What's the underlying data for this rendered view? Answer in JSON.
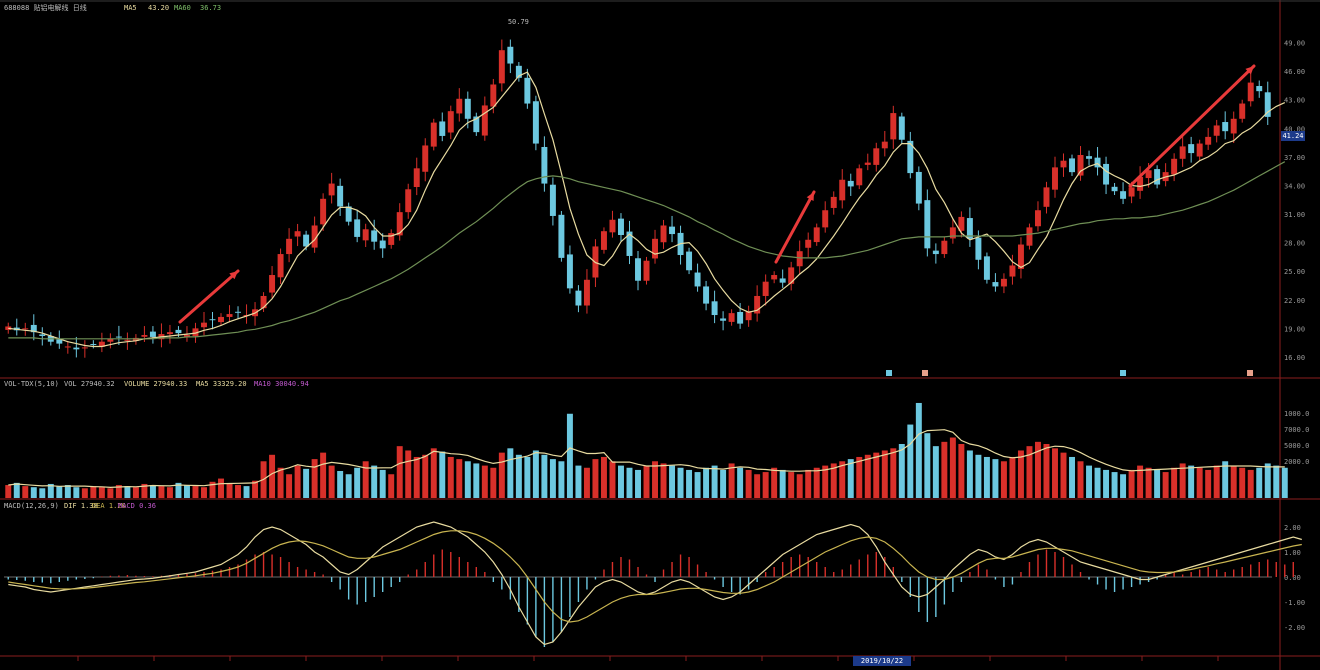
{
  "header": {
    "security": "688088 贴铝电解线 日线",
    "ma_label": "MA5",
    "ma_value": "43.20",
    "price_label": "MA60",
    "price_value": "36.73"
  },
  "colors": {
    "background": "#000000",
    "up_candle": "#d9302a",
    "down_candle": "#6cc8e0",
    "ma_short": "#e8dba0",
    "ma_long": "#6f8f55",
    "arrow": "#e83a3a",
    "axis": "#8a1e1e",
    "macd_dif": "#e8dba0",
    "macd_dea": "#c8b450"
  },
  "volume_header": {
    "label": "VOL-TDX(5,10)",
    "vol": "VOL 27940.32",
    "volume": "VOLUME 27940.33",
    "ma5": "MA5 33329.20",
    "ma10": "MA10 30040.94"
  },
  "macd_header": {
    "label": "MACD(12,26,9)",
    "dif": "DIF 1.38",
    "dea": "DEA 1.20",
    "macd": "MACD 0.36"
  },
  "current_price_tag": "41.24",
  "bottom_date_tag": "2019/10/22",
  "chart_data": [
    {
      "type": "candlestick",
      "title": "",
      "peak_label": "50.79",
      "y_ticks": [
        "49.00",
        "46.00",
        "43.00",
        "40.00",
        "37.00",
        "34.00",
        "31.00",
        "28.00",
        "25.00",
        "22.00",
        "19.00",
        "16.00"
      ],
      "ylim": [
        14,
        52
      ],
      "closes": [
        19.2,
        18.8,
        19.0,
        18.6,
        18.2,
        17.6,
        17.4,
        17.1,
        16.8,
        17.0,
        17.3,
        17.6,
        17.9,
        18.1,
        17.8,
        18.0,
        18.3,
        18.1,
        18.4,
        18.6,
        18.5,
        18.3,
        19.0,
        19.6,
        19.9,
        20.2,
        20.5,
        20.7,
        20.4,
        21.0,
        22.4,
        24.6,
        26.8,
        28.4,
        29.2,
        27.6,
        29.8,
        32.6,
        34.2,
        31.8,
        30.2,
        28.6,
        29.4,
        28.1,
        27.4,
        29.0,
        31.2,
        33.6,
        35.8,
        38.2,
        40.6,
        39.2,
        41.8,
        43.1,
        41.0,
        39.6,
        42.4,
        44.6,
        48.2,
        46.8,
        45.3,
        42.6,
        38.4,
        34.2,
        30.8,
        26.4,
        23.2,
        21.4,
        24.1,
        27.6,
        29.2,
        30.4,
        28.8,
        26.6,
        24.0,
        26.1,
        28.4,
        29.8,
        28.9,
        26.7,
        25.1,
        23.4,
        21.6,
        20.4,
        19.8,
        20.6,
        19.5,
        20.8,
        22.4,
        23.9,
        24.6,
        23.8,
        25.4,
        27.1,
        28.3,
        29.6,
        31.4,
        32.8,
        34.6,
        33.9,
        35.8,
        36.4,
        37.9,
        38.6,
        41.6,
        38.8,
        35.3,
        32.1,
        27.4,
        26.8,
        28.2,
        29.6,
        30.7,
        28.4,
        26.2,
        24.1,
        23.4,
        24.2,
        25.6,
        27.8,
        29.6,
        31.4,
        33.8,
        35.9,
        36.6,
        35.4,
        37.2,
        36.8,
        35.9,
        34.1,
        33.4,
        32.6,
        33.8,
        34.9,
        35.6,
        34.1,
        35.4,
        36.8,
        38.1,
        37.4,
        38.4,
        39.1,
        40.3,
        39.7,
        41.0,
        42.6,
        44.8,
        43.9,
        41.2
      ],
      "ma_short": [
        19.0,
        18.9,
        18.8,
        18.7,
        18.5,
        18.2,
        17.9,
        17.6,
        17.4,
        17.2,
        17.1,
        17.1,
        17.3,
        17.5,
        17.6,
        17.7,
        17.9,
        18.0,
        18.1,
        18.2,
        18.3,
        18.4,
        18.5,
        18.8,
        19.0,
        19.3,
        19.7,
        20.0,
        20.3,
        20.6,
        21.2,
        22.1,
        23.4,
        25.0,
        26.6,
        27.5,
        28.3,
        29.6,
        30.9,
        31.7,
        31.7,
        31.4,
        30.8,
        29.6,
        28.7,
        28.7,
        29.0,
        29.9,
        31.4,
        33.5,
        35.4,
        36.8,
        38.2,
        39.8,
        40.6,
        41.0,
        41.6,
        42.2,
        43.3,
        44.4,
        45.5,
        45.9,
        44.3,
        41.5,
        38.8,
        35.3,
        31.6,
        28.9,
        26.7,
        25.9,
        25.6,
        26.6,
        28.1,
        28.9,
        28.2,
        27.3,
        26.8,
        27.0,
        27.5,
        27.9,
        28.0,
        27.1,
        25.8,
        24.2,
        23.0,
        21.9,
        21.1,
        20.7,
        20.9,
        21.6,
        22.4,
        23.1,
        23.8,
        24.7,
        25.4,
        26.3,
        27.5,
        28.7,
        30.0,
        31.4,
        32.7,
        33.8,
        35.1,
        36.1,
        37.5,
        38.4,
        38.4,
        37.4,
        35.8,
        33.6,
        32.2,
        30.5,
        29.0,
        28.3,
        28.6,
        28.9,
        28.1,
        27.1,
        26.0,
        25.4,
        25.9,
        27.3,
        28.6,
        30.5,
        32.5,
        34.2,
        35.5,
        36.0,
        36.3,
        35.5,
        35.0,
        34.6,
        34.0,
        33.9,
        34.1,
        34.6,
        34.9,
        35.1,
        35.5,
        35.9,
        36.6,
        37.0,
        37.6,
        38.4,
        38.7,
        39.5,
        40.0,
        40.8,
        41.7,
        42.3,
        42.7
      ],
      "ma_long": [
        18.0,
        18.0,
        18.0,
        18.0,
        17.9,
        17.9,
        17.9,
        17.9,
        17.9,
        17.9,
        17.9,
        17.9,
        17.9,
        17.9,
        17.9,
        17.9,
        17.9,
        17.9,
        18.0,
        18.0,
        18.0,
        18.1,
        18.1,
        18.2,
        18.3,
        18.4,
        18.5,
        18.6,
        18.8,
        18.9,
        19.1,
        19.3,
        19.6,
        19.8,
        20.1,
        20.4,
        20.7,
        21.1,
        21.5,
        21.9,
        22.2,
        22.6,
        23.0,
        23.4,
        23.8,
        24.2,
        24.7,
        25.2,
        25.8,
        26.4,
        27.0,
        27.6,
        28.3,
        29.0,
        29.6,
        30.2,
        30.9,
        31.6,
        32.4,
        33.1,
        33.8,
        34.4,
        34.7,
        34.9,
        35.0,
        34.9,
        34.7,
        34.4,
        34.2,
        34.0,
        33.8,
        33.6,
        33.4,
        33.1,
        32.8,
        32.5,
        32.2,
        31.9,
        31.5,
        31.1,
        30.7,
        30.2,
        29.8,
        29.3,
        28.9,
        28.4,
        28.0,
        27.6,
        27.3,
        27.0,
        26.8,
        26.6,
        26.5,
        26.4,
        26.4,
        26.4,
        26.4,
        26.5,
        26.6,
        26.8,
        27.0,
        27.2,
        27.5,
        27.8,
        28.1,
        28.4,
        28.5,
        28.6,
        28.6,
        28.6,
        28.6,
        28.7,
        28.7,
        28.7,
        28.7,
        28.7,
        28.7,
        28.7,
        28.7,
        28.8,
        28.9,
        29.0,
        29.2,
        29.4,
        29.6,
        29.8,
        30.0,
        30.1,
        30.3,
        30.4,
        30.5,
        30.5,
        30.6,
        30.6,
        30.7,
        30.8,
        31.0,
        31.2,
        31.4,
        31.7,
        32.0,
        32.3,
        32.7,
        33.1,
        33.5,
        34.0,
        34.5,
        35.0,
        35.5,
        36.0,
        36.5
      ],
      "arrows": 3
    },
    {
      "type": "bar",
      "title": "",
      "y_ticks": [
        "1000.0",
        "7000.0",
        "5000.0",
        "2000.0"
      ],
      "ylim": [
        0,
        100
      ],
      "values": [
        12,
        14,
        11,
        10,
        9,
        13,
        11,
        12,
        10,
        9,
        11,
        10,
        9,
        12,
        11,
        10,
        13,
        12,
        11,
        10,
        14,
        12,
        11,
        10,
        15,
        18,
        13,
        12,
        11,
        16,
        34,
        40,
        28,
        22,
        30,
        27,
        36,
        42,
        30,
        25,
        22,
        28,
        34,
        30,
        26,
        22,
        48,
        44,
        38,
        40,
        46,
        43,
        38,
        36,
        34,
        32,
        30,
        28,
        42,
        46,
        40,
        38,
        44,
        40,
        36,
        34,
        78,
        30,
        28,
        36,
        38,
        34,
        30,
        28,
        26,
        30,
        34,
        32,
        30,
        28,
        26,
        24,
        28,
        30,
        26,
        32,
        28,
        26,
        22,
        24,
        28,
        26,
        24,
        22,
        26,
        28,
        30,
        32,
        34,
        36,
        38,
        40,
        42,
        44,
        46,
        50,
        68,
        88,
        60,
        48,
        52,
        56,
        50,
        44,
        40,
        38,
        36,
        34,
        38,
        44,
        48,
        52,
        50,
        46,
        42,
        38,
        34,
        30,
        28,
        26,
        24,
        22,
        26,
        30,
        28,
        26,
        24,
        28,
        32,
        30,
        28,
        26,
        30,
        34,
        30,
        28,
        26,
        28,
        32,
        30,
        28
      ],
      "colors_pattern": "up_down_mixed"
    },
    {
      "type": "bar",
      "title": "",
      "y_ticks": [
        "2.00",
        "1.00",
        "0.00",
        "-1.00",
        "-2.00"
      ],
      "ylim": [
        -3,
        2.6
      ],
      "hist": [
        -0.1,
        -0.12,
        -0.15,
        -0.2,
        -0.22,
        -0.25,
        -0.2,
        -0.15,
        -0.1,
        -0.08,
        -0.05,
        0.02,
        0.05,
        0.06,
        0.08,
        0.05,
        0.04,
        0.03,
        0.05,
        0.08,
        0.1,
        0.12,
        0.15,
        0.2,
        0.25,
        0.3,
        0.4,
        0.5,
        0.7,
        0.9,
        1.0,
        0.9,
        0.8,
        0.6,
        0.4,
        0.3,
        0.2,
        0.1,
        -0.2,
        -0.5,
        -0.9,
        -1.1,
        -1.0,
        -0.8,
        -0.6,
        -0.4,
        -0.2,
        0.1,
        0.3,
        0.6,
        0.9,
        1.1,
        1.0,
        0.8,
        0.6,
        0.4,
        0.2,
        -0.2,
        -0.5,
        -0.9,
        -1.4,
        -1.9,
        -2.4,
        -2.8,
        -2.6,
        -2.2,
        -1.6,
        -1.0,
        -0.5,
        -0.1,
        0.3,
        0.6,
        0.8,
        0.7,
        0.4,
        0.1,
        -0.2,
        0.3,
        0.6,
        0.9,
        0.8,
        0.5,
        0.2,
        -0.1,
        -0.4,
        -0.6,
        -0.7,
        -0.5,
        -0.2,
        0.2,
        0.4,
        0.6,
        0.8,
        0.9,
        0.8,
        0.6,
        0.4,
        0.2,
        0.3,
        0.5,
        0.7,
        0.9,
        1.0,
        0.8,
        0.4,
        -0.2,
        -0.8,
        -1.4,
        -1.8,
        -1.6,
        -1.1,
        -0.6,
        -0.2,
        0.2,
        0.5,
        0.3,
        -0.1,
        -0.4,
        -0.3,
        0.2,
        0.6,
        0.9,
        1.1,
        1.0,
        0.8,
        0.5,
        0.2,
        -0.1,
        -0.3,
        -0.5,
        -0.6,
        -0.5,
        -0.4,
        -0.3,
        -0.2,
        -0.1,
        0.1,
        0.2,
        0.1,
        0.2,
        0.3,
        0.4,
        0.3,
        0.2,
        0.3,
        0.4,
        0.5,
        0.6,
        0.7,
        0.6,
        0.5,
        0.6
      ],
      "dif": [
        -0.3,
        -0.35,
        -0.4,
        -0.5,
        -0.55,
        -0.6,
        -0.55,
        -0.5,
        -0.45,
        -0.4,
        -0.35,
        -0.3,
        -0.25,
        -0.2,
        -0.15,
        -0.1,
        -0.08,
        -0.05,
        0.0,
        0.05,
        0.1,
        0.15,
        0.2,
        0.3,
        0.4,
        0.5,
        0.7,
        0.9,
        1.2,
        1.6,
        1.9,
        2.0,
        1.9,
        1.7,
        1.5,
        1.3,
        1.0,
        0.8,
        0.5,
        0.2,
        0.1,
        0.3,
        0.6,
        0.9,
        1.2,
        1.4,
        1.6,
        1.8,
        2.0,
        2.1,
        2.2,
        2.1,
        2.0,
        1.8,
        1.6,
        1.3,
        1.0,
        0.6,
        0.1,
        -0.5,
        -1.2,
        -1.8,
        -2.4,
        -2.7,
        -2.6,
        -2.2,
        -1.7,
        -1.2,
        -0.8,
        -0.4,
        -0.2,
        -0.1,
        -0.2,
        -0.4,
        -0.6,
        -0.7,
        -0.6,
        -0.4,
        -0.2,
        -0.1,
        -0.2,
        -0.4,
        -0.6,
        -0.8,
        -0.9,
        -0.8,
        -0.6,
        -0.3,
        0.0,
        0.3,
        0.6,
        0.9,
        1.1,
        1.3,
        1.5,
        1.7,
        1.8,
        1.9,
        2.0,
        2.1,
        2.0,
        1.7,
        1.2,
        0.6,
        0.1,
        -0.4,
        -0.7,
        -0.8,
        -0.7,
        -0.4,
        -0.1,
        0.3,
        0.6,
        0.9,
        1.1,
        1.0,
        0.8,
        0.7,
        0.9,
        1.2,
        1.4,
        1.5,
        1.4,
        1.2,
        1.0,
        0.8,
        0.6,
        0.5,
        0.4,
        0.3,
        0.2,
        0.1,
        0.0,
        -0.1,
        -0.1,
        0.0,
        0.1,
        0.2,
        0.3,
        0.4,
        0.5,
        0.6,
        0.7,
        0.8,
        0.9,
        1.0,
        1.1,
        1.2,
        1.3,
        1.4,
        1.5,
        1.6,
        1.5
      ],
      "dea": [
        -0.2,
        -0.25,
        -0.3,
        -0.35,
        -0.4,
        -0.45,
        -0.47,
        -0.48,
        -0.47,
        -0.45,
        -0.42,
        -0.38,
        -0.34,
        -0.3,
        -0.26,
        -0.22,
        -0.19,
        -0.15,
        -0.11,
        -0.07,
        -0.03,
        0.01,
        0.05,
        0.1,
        0.15,
        0.22,
        0.3,
        0.4,
        0.55,
        0.75,
        0.95,
        1.15,
        1.3,
        1.4,
        1.45,
        1.42,
        1.35,
        1.25,
        1.1,
        0.95,
        0.8,
        0.75,
        0.75,
        0.8,
        0.9,
        1.0,
        1.1,
        1.25,
        1.4,
        1.55,
        1.7,
        1.8,
        1.85,
        1.85,
        1.8,
        1.7,
        1.55,
        1.35,
        1.1,
        0.8,
        0.45,
        0.0,
        -0.5,
        -1.0,
        -1.4,
        -1.7,
        -1.8,
        -1.75,
        -1.6,
        -1.4,
        -1.2,
        -1.0,
        -0.85,
        -0.75,
        -0.7,
        -0.7,
        -0.68,
        -0.62,
        -0.55,
        -0.48,
        -0.45,
        -0.45,
        -0.5,
        -0.56,
        -0.62,
        -0.65,
        -0.65,
        -0.6,
        -0.5,
        -0.35,
        -0.2,
        0.0,
        0.2,
        0.4,
        0.6,
        0.8,
        1.0,
        1.15,
        1.3,
        1.45,
        1.55,
        1.6,
        1.55,
        1.4,
        1.15,
        0.85,
        0.5,
        0.2,
        0.0,
        -0.1,
        -0.1,
        0.0,
        0.15,
        0.35,
        0.55,
        0.7,
        0.75,
        0.75,
        0.8,
        0.9,
        1.0,
        1.1,
        1.15,
        1.15,
        1.1,
        1.05,
        0.95,
        0.85,
        0.75,
        0.65,
        0.55,
        0.45,
        0.35,
        0.25,
        0.2,
        0.18,
        0.18,
        0.2,
        0.25,
        0.3,
        0.38,
        0.45,
        0.53,
        0.6,
        0.68,
        0.76,
        0.84,
        0.92,
        1.0,
        1.08,
        1.16,
        1.24,
        1.3
      ]
    }
  ]
}
